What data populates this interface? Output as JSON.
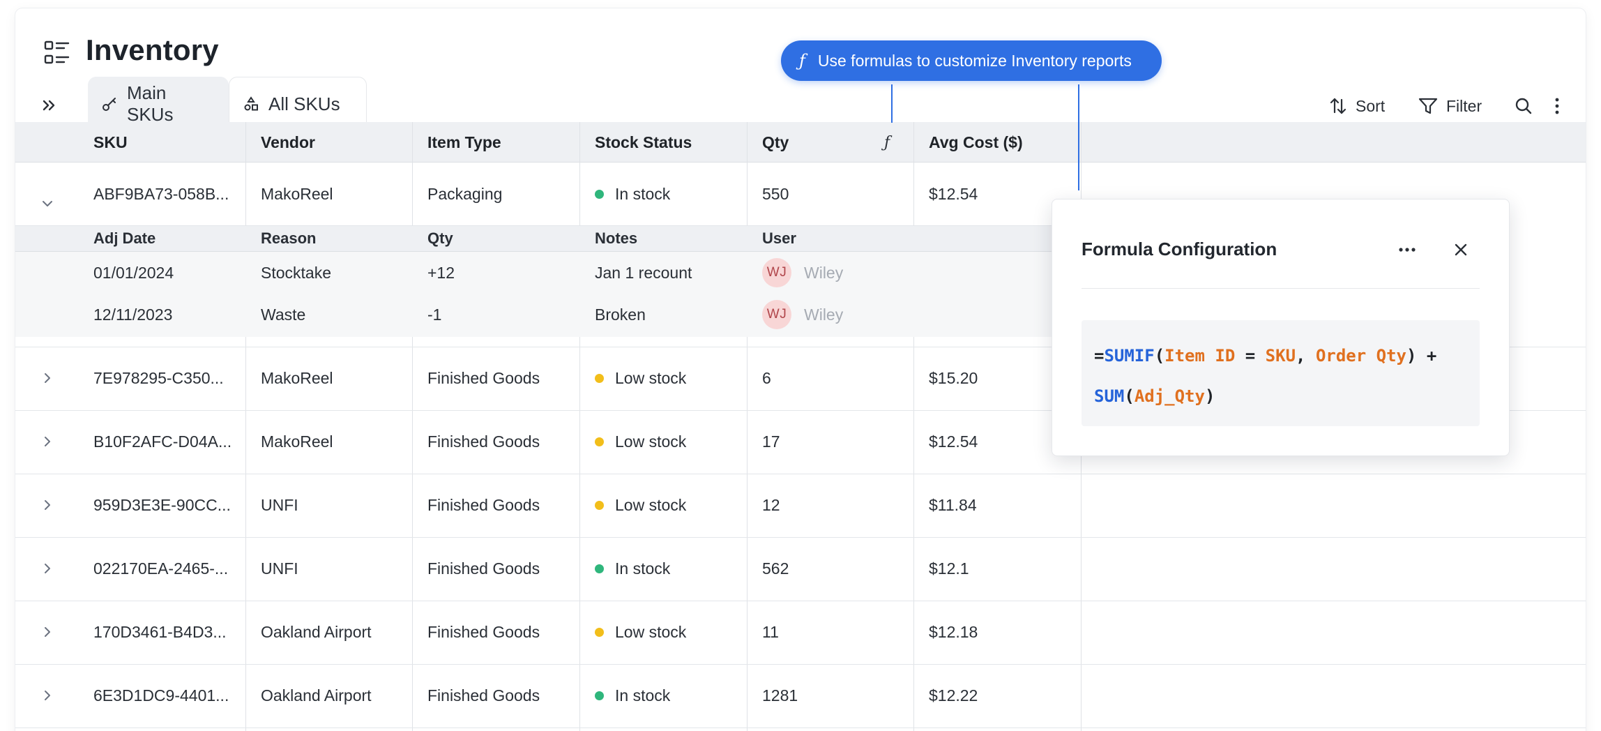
{
  "page": {
    "title": "Inventory",
    "title_icon": "list-settings-icon"
  },
  "tabs": [
    {
      "label": "Main SKUs",
      "icon": "key-icon",
      "active": true
    },
    {
      "label": "All SKUs",
      "icon": "shapes-icon",
      "active": false
    }
  ],
  "toolbar": {
    "sort_label": "Sort",
    "filter_label": "Filter"
  },
  "callout": {
    "icon": "function-icon",
    "text": "Use formulas to customize Inventory reports"
  },
  "columns": [
    "SKU",
    "Vendor",
    "Item Type",
    "Stock Status",
    "Qty",
    "Avg Cost ($)"
  ],
  "rows": [
    {
      "sku": "ABF9BA73-058B...",
      "vendor": "MakoReel",
      "type": "Packaging",
      "status": "In stock",
      "status_color": "#2fb67c",
      "qty": "550",
      "cost": "$12.54",
      "expanded": true
    },
    {
      "sku": "7E978295-C350...",
      "vendor": "MakoReel",
      "type": "Finished Goods",
      "status": "Low stock",
      "status_color": "#f2be1a",
      "qty": "6",
      "cost": "$15.20"
    },
    {
      "sku": "B10F2AFC-D04A...",
      "vendor": "MakoReel",
      "type": "Finished Goods",
      "status": "Low stock",
      "status_color": "#f2be1a",
      "qty": "17",
      "cost": "$12.54"
    },
    {
      "sku": "959D3E3E-90CC...",
      "vendor": "UNFI",
      "type": "Finished Goods",
      "status": "Low stock",
      "status_color": "#f2be1a",
      "qty": "12",
      "cost": "$11.84"
    },
    {
      "sku": "022170EA-2465-...",
      "vendor": "UNFI",
      "type": "Finished Goods",
      "status": "In stock",
      "status_color": "#2fb67c",
      "qty": "562",
      "cost": "$12.1"
    },
    {
      "sku": "170D3461-B4D3...",
      "vendor": "Oakland Airport",
      "type": "Finished Goods",
      "status": "Low stock",
      "status_color": "#f2be1a",
      "qty": "11",
      "cost": "$12.18"
    },
    {
      "sku": "6E3D1DC9-4401...",
      "vendor": "Oakland Airport",
      "type": "Finished Goods",
      "status": "In stock",
      "status_color": "#2fb67c",
      "qty": "1281",
      "cost": "$12.22"
    }
  ],
  "sub_table": {
    "columns": [
      "Adj Date",
      "Reason",
      "Qty",
      "Notes",
      "User"
    ],
    "rows": [
      {
        "date": "01/01/2024",
        "reason": "Stocktake",
        "qty": "+12",
        "notes": "Jan 1 recount",
        "initials": "WJ",
        "user": "Wiley"
      },
      {
        "date": "12/11/2023",
        "reason": "Waste",
        "qty": "-1",
        "notes": "Broken",
        "initials": "WJ",
        "user": "Wiley"
      }
    ]
  },
  "formula_panel": {
    "title": "Formula Configuration",
    "tokens_line1": [
      {
        "t": "=",
        "k": "op"
      },
      {
        "t": "SUMIF",
        "k": "fn"
      },
      {
        "t": "(",
        "k": "op"
      },
      {
        "t": "Item ID",
        "k": "arg"
      },
      {
        "t": " = ",
        "k": "op"
      },
      {
        "t": "SKU",
        "k": "arg"
      },
      {
        "t": ", ",
        "k": "op"
      },
      {
        "t": "Order Qty",
        "k": "arg"
      },
      {
        "t": ") +",
        "k": "op"
      }
    ],
    "tokens_line2": [
      {
        "t": "SUM",
        "k": "fn"
      },
      {
        "t": "(",
        "k": "op"
      },
      {
        "t": "Adj_Qty",
        "k": "arg"
      },
      {
        "t": ")",
        "k": "op"
      }
    ]
  },
  "colors": {
    "accent": "#2f6fe3",
    "in_stock": "#2fb67c",
    "low_stock": "#f2be1a",
    "header_bg": "#eef0f3",
    "formula_fn": "#2563d9",
    "formula_arg": "#e0701f"
  }
}
